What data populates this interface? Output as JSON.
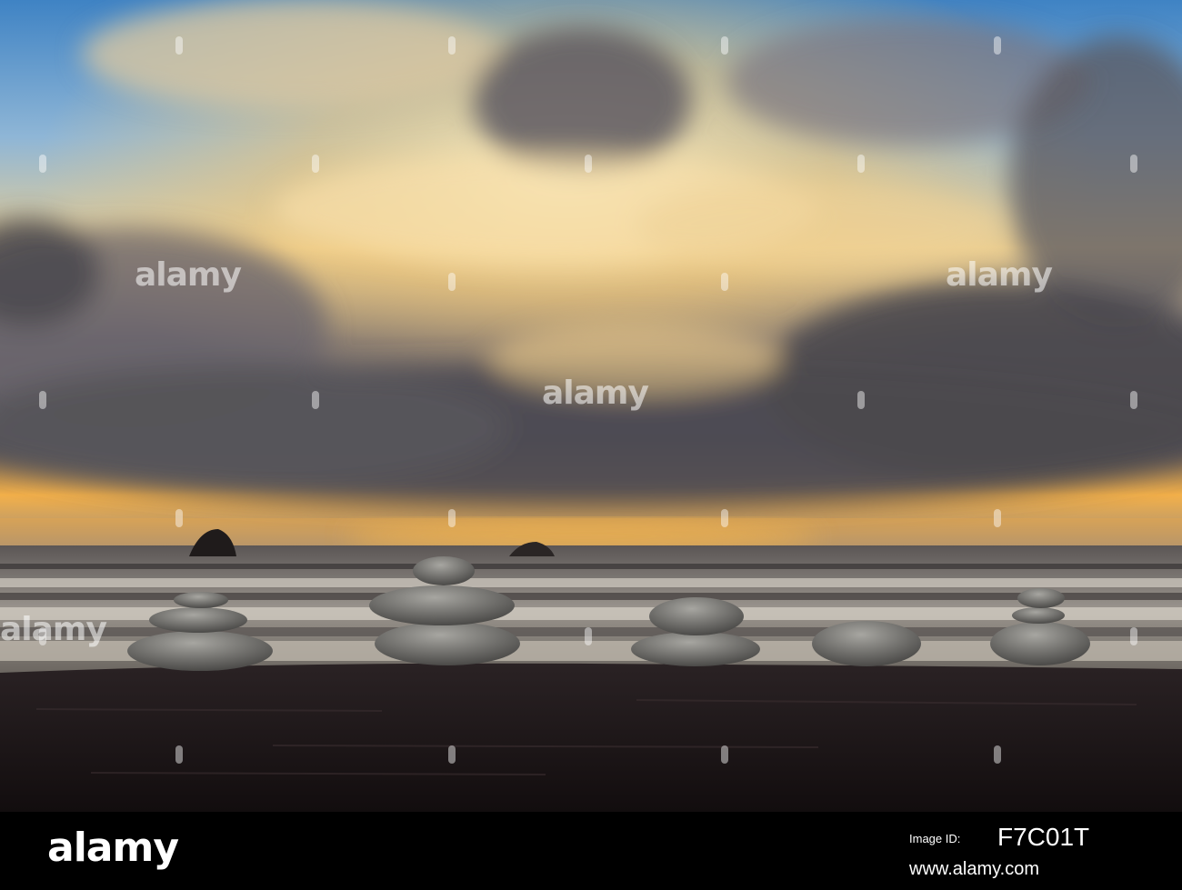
{
  "footer": {
    "logo": "alamy",
    "image_id_label": "Image ID:",
    "image_id": "F7C01T",
    "url": "www.alamy.com"
  },
  "watermark": {
    "text": "alamy"
  },
  "colors": {
    "sky_top": "#4a8fc8",
    "sky_glow": "#f2c36b",
    "cloud_dark": "#4e4c52",
    "sea": "#6d6a68",
    "log": "#1e1718",
    "stone": "#8a8a86"
  }
}
